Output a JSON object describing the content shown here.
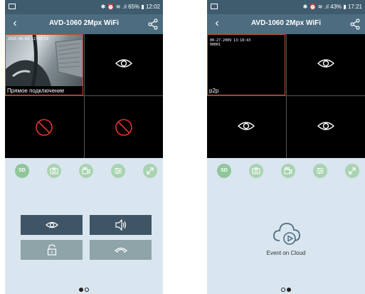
{
  "phones": [
    {
      "status": {
        "right": "✱ ⏰ ≋ .ıl 65% ▮ 12:02"
      },
      "title": "AVD-1060 2Mpx WiFi",
      "cells": [
        {
          "label": "Прямое подключение",
          "timestamp": "2016-08-03 12:53:52",
          "state": "live"
        },
        {
          "state": "eye"
        },
        {
          "state": "blocked"
        },
        {
          "state": "blocked"
        }
      ],
      "toolbar": {
        "sd": "SD"
      },
      "pager": [
        true,
        false
      ]
    },
    {
      "status": {
        "right": "✱ ⏰ ≋ .ıl 43% ▮ 17:21"
      },
      "title": "AVD-1060 2Mpx WiFi",
      "cells": [
        {
          "label": "p2p",
          "osd": [
            "00-27-2009 13:18:43",
            "00001"
          ],
          "state": "dark"
        },
        {
          "state": "eye"
        },
        {
          "state": "eye"
        },
        {
          "state": "eye"
        }
      ],
      "toolbar": {
        "sd": "SD"
      },
      "cloud_label": "Event on Cloud",
      "pager": [
        false,
        true
      ]
    }
  ]
}
